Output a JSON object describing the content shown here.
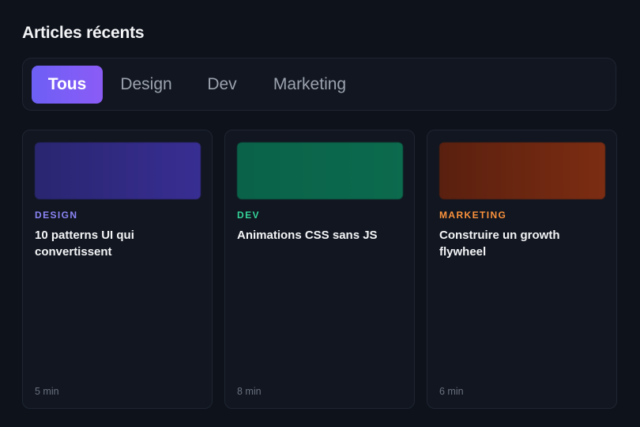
{
  "section": {
    "title": "Articles récents"
  },
  "tabs": [
    {
      "label": "Tous",
      "active": true
    },
    {
      "label": "Design",
      "active": false
    },
    {
      "label": "Dev",
      "active": false
    },
    {
      "label": "Marketing",
      "active": false
    }
  ],
  "cards": [
    {
      "category": "DESIGN",
      "category_color": "#8b85f5",
      "thumb_gradient": [
        "#2a2670",
        "#382e93"
      ],
      "title": "10 patterns UI qui convertissent",
      "read_time": "5 min"
    },
    {
      "category": "DEV",
      "category_color": "#34d399",
      "thumb_gradient": [
        "#0a6349",
        "#0c6a4d"
      ],
      "title": "Animations CSS sans JS",
      "read_time": "8 min"
    },
    {
      "category": "MARKETING",
      "category_color": "#fb923c",
      "thumb_gradient": [
        "#5a200f",
        "#7c2d12"
      ],
      "title": "Construire un growth flywheel",
      "read_time": "6 min"
    }
  ]
}
